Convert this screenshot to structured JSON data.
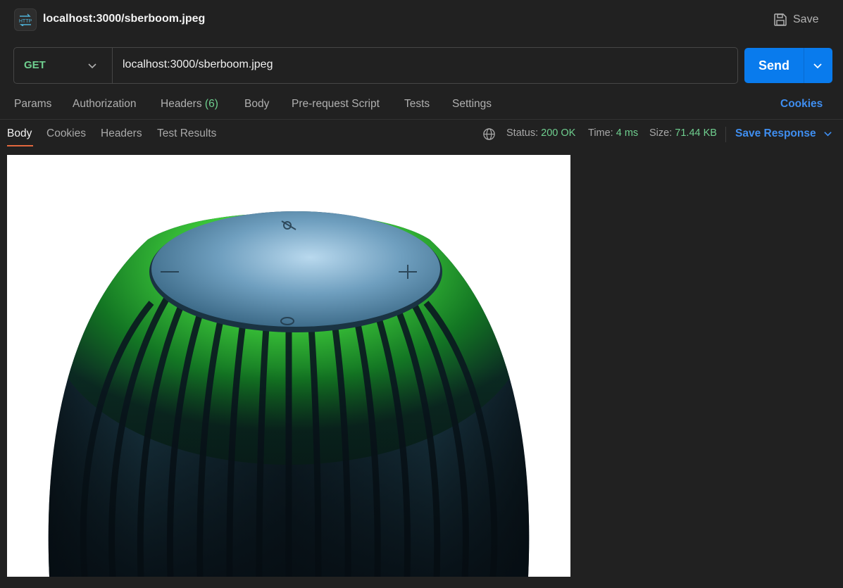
{
  "app": {
    "title": "localhost:3000/sberboom.jpeg",
    "save_label": "Save"
  },
  "request": {
    "method": "GET",
    "url": "localhost:3000/sberboom.jpeg",
    "send_label": "Send"
  },
  "request_tabs": {
    "params": "Params",
    "authorization": "Authorization",
    "headers": "Headers",
    "headers_count": "(6)",
    "body": "Body",
    "prerequest": "Pre-request Script",
    "tests": "Tests",
    "settings": "Settings",
    "cookies": "Cookies"
  },
  "response": {
    "tabs": {
      "body": "Body",
      "cookies": "Cookies",
      "headers": "Headers",
      "test_results": "Test Results"
    },
    "status_label": "Status:",
    "status_value": "200 OK",
    "time_label": "Time:",
    "time_value": "4 ms",
    "size_label": "Size:",
    "size_value": "71.44 KB",
    "save_response": "Save Response"
  },
  "icons": {
    "app": "http-icon",
    "save": "floppy-disk-icon",
    "method_dropdown": "chevron-down-icon",
    "send_dropdown": "chevron-down-icon",
    "network": "globe-icon",
    "save_response": "chevron-down-icon"
  },
  "colors": {
    "accent": "#097bed",
    "link": "#3f8ef0",
    "success": "#6fcf8f",
    "active_tab_underline": "#e2673e",
    "background": "#212121"
  },
  "preview": {
    "image_subject": "smart-speaker-photo"
  }
}
